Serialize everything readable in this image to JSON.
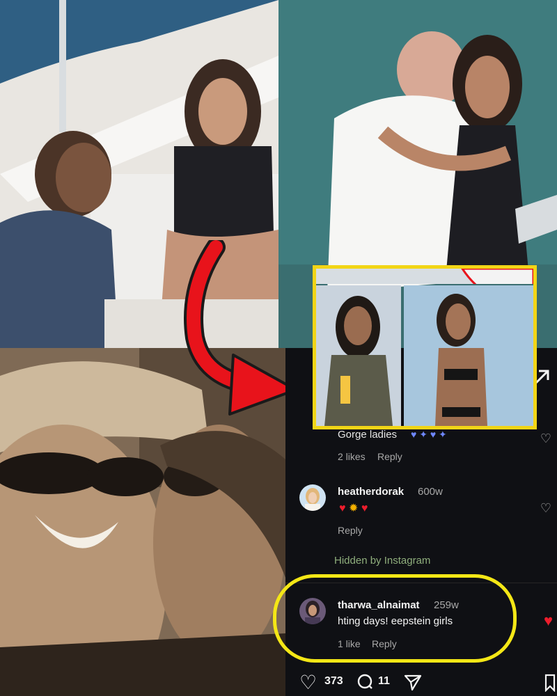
{
  "comments": {
    "first": {
      "text": "Gorge ladies",
      "likes": "2 likes",
      "reply": "Reply"
    },
    "second": {
      "username": "heatherdorak",
      "age": "600w",
      "reply": "Reply"
    },
    "hidden_label": "Hidden by Instagram",
    "third": {
      "username": "tharwa_alnaimat",
      "age": "259w",
      "text": "hting days! eepstein girls",
      "likes": "1 like",
      "reply": "Reply"
    }
  },
  "actions": {
    "likes_count": "373",
    "comments_count": "11"
  },
  "colors": {
    "highlight_yellow": "#f2d516",
    "arrow_red": "#e8131b",
    "like_red": "#ed1d2c"
  }
}
